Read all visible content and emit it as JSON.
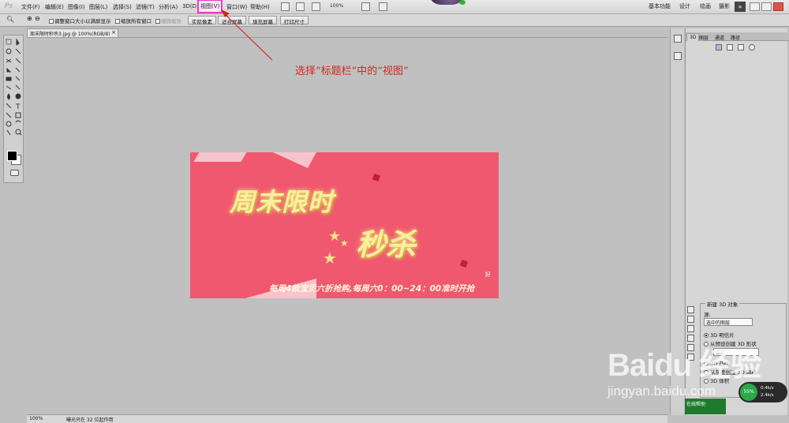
{
  "menubar": {
    "logo": "Ps",
    "items": [
      "文件(F)",
      "编辑(E)",
      "图像(I)",
      "图层(L)",
      "选择(S)",
      "滤镜(T)",
      "分析(A)",
      "3D(D)",
      "视图(V)",
      "窗口(W)",
      "帮助(H)"
    ],
    "zoom": "100%",
    "workspaces": [
      "基本功能",
      "设计",
      "绘画",
      "摄影"
    ],
    "expand_label": "»"
  },
  "options": {
    "resize_windows": "调整窗口大小以满屏显示",
    "zoom_all": "缩放所有窗口",
    "scrubby_zoom": "细微缩放",
    "buttons": [
      "实际像素",
      "适合屏幕",
      "填充屏幕",
      "打印尺寸"
    ]
  },
  "document": {
    "tab_title": "周末限时秒杀3.jpg @ 100%(RGB/8)",
    "close": "×"
  },
  "banner": {
    "line1": "周末限时",
    "line2": "秒杀",
    "slogan": "每周4款宝贝六折抢购,每周六0：00~24：00准时开抢",
    "deco": "好"
  },
  "annotation": "选择“标题栏”中的“视图”",
  "status": {
    "zoom": "100%",
    "info": "曝光只在 32 位起作用"
  },
  "panel": {
    "tabs": [
      "3D",
      "图层",
      "通道",
      "路径"
    ],
    "new3d": {
      "title": "新建 3D 对象",
      "source_label": "源:",
      "source_value": "选中的图层",
      "options": [
        "3D 明信片",
        "从预设创建 3D 形状",
        "3D 凸纹",
        "从灰度创建 3D 网格",
        "3D 体积"
      ],
      "shape_value": "锥形"
    }
  },
  "speed": {
    "percent": "55%",
    "up": "0.4k/s",
    "down": "2.4k/s"
  },
  "greenwidget": "在线帮助",
  "watermark": {
    "logo": "Baidu 经验",
    "url": "jingyan.baidu.com"
  },
  "colors": {
    "annotation": "#d0281e",
    "highlight": "#e040c8",
    "banner": "#f0586f",
    "banner_text": "#f9f0a0"
  }
}
